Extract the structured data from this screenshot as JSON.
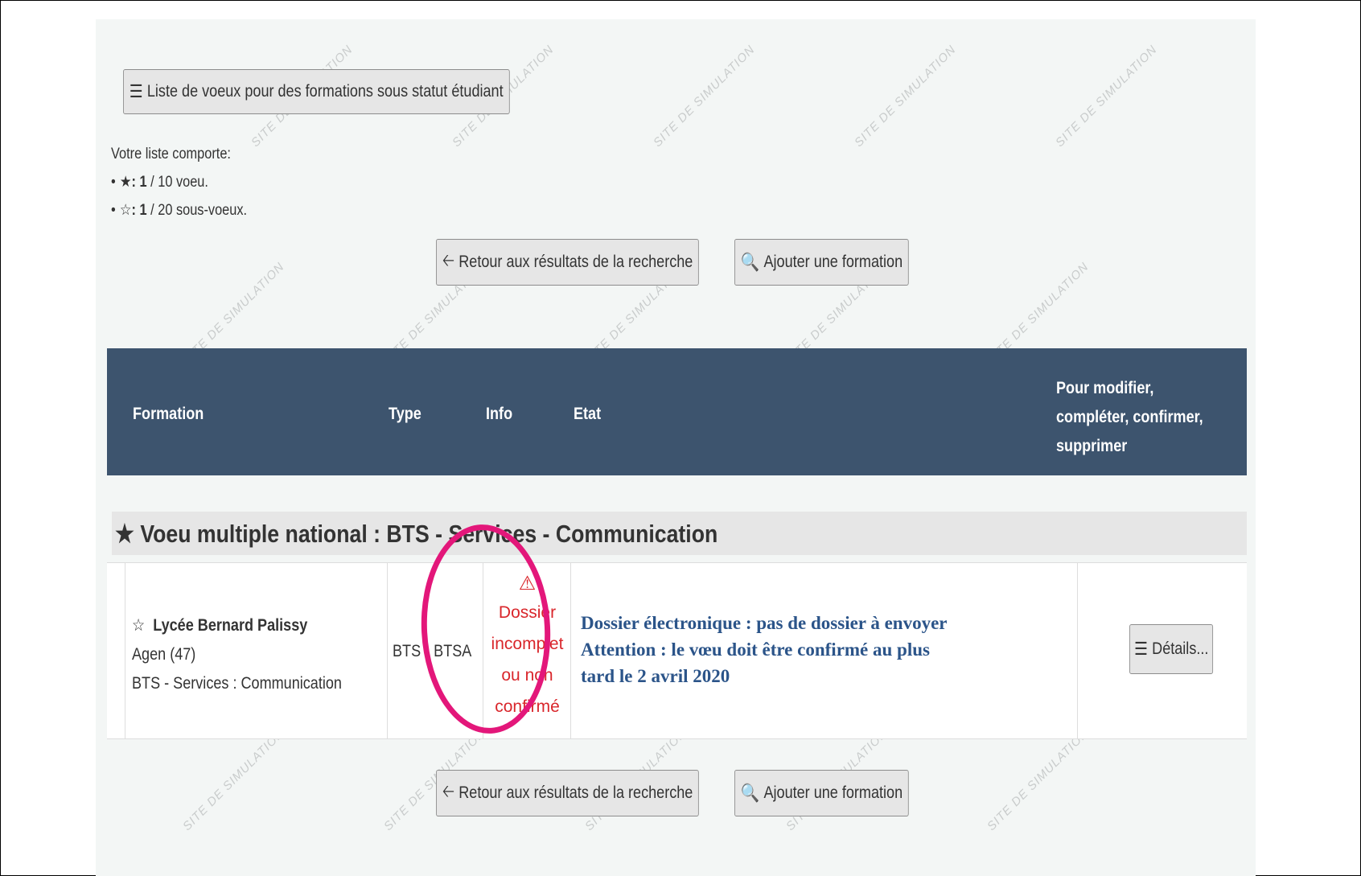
{
  "header_button": {
    "icon": "list-icon",
    "label": "Liste de voeux pour des formations sous statut étudiant"
  },
  "summary": {
    "intro": "Votre liste comporte:",
    "voeux": {
      "icon": "star-filled-icon",
      "count": "1",
      "text": " / 10 voeu."
    },
    "sous_voeux": {
      "icon": "star-outline-icon",
      "count": "1",
      "text": " / 20 sous-voeux."
    }
  },
  "actions": {
    "back_label": "Retour aux résultats de la recherche",
    "add_label": "Ajouter une formation"
  },
  "table": {
    "headers": {
      "formation": "Formation",
      "type": "Type",
      "info": "Info",
      "etat": "Etat",
      "modify": [
        "Pour modifier,",
        "compléter, confirmer,",
        "supprimer"
      ]
    },
    "group": {
      "title": "Voeu multiple national : BTS - Services - Communication"
    },
    "rows": [
      {
        "name": "Lycée Bernard Palissy",
        "city": "Agen (47)",
        "program": "BTS - Services : Communication",
        "type": "BTS - BTSA",
        "info": [
          "Dossier",
          "incomplet",
          "ou non",
          "confirmé"
        ],
        "etat": [
          "Dossier électronique : pas de dossier à envoyer",
          "Attention : le vœu doit être confirmé au plus tard le 2 avril 2020"
        ],
        "details_label": "Détails..."
      }
    ]
  },
  "watermark": "SITE DE SIMULATION",
  "colors": {
    "header_bg": "#3d546e",
    "warning": "#d9262b",
    "etat_text": "#2b5489",
    "highlight": "#e3177a"
  }
}
